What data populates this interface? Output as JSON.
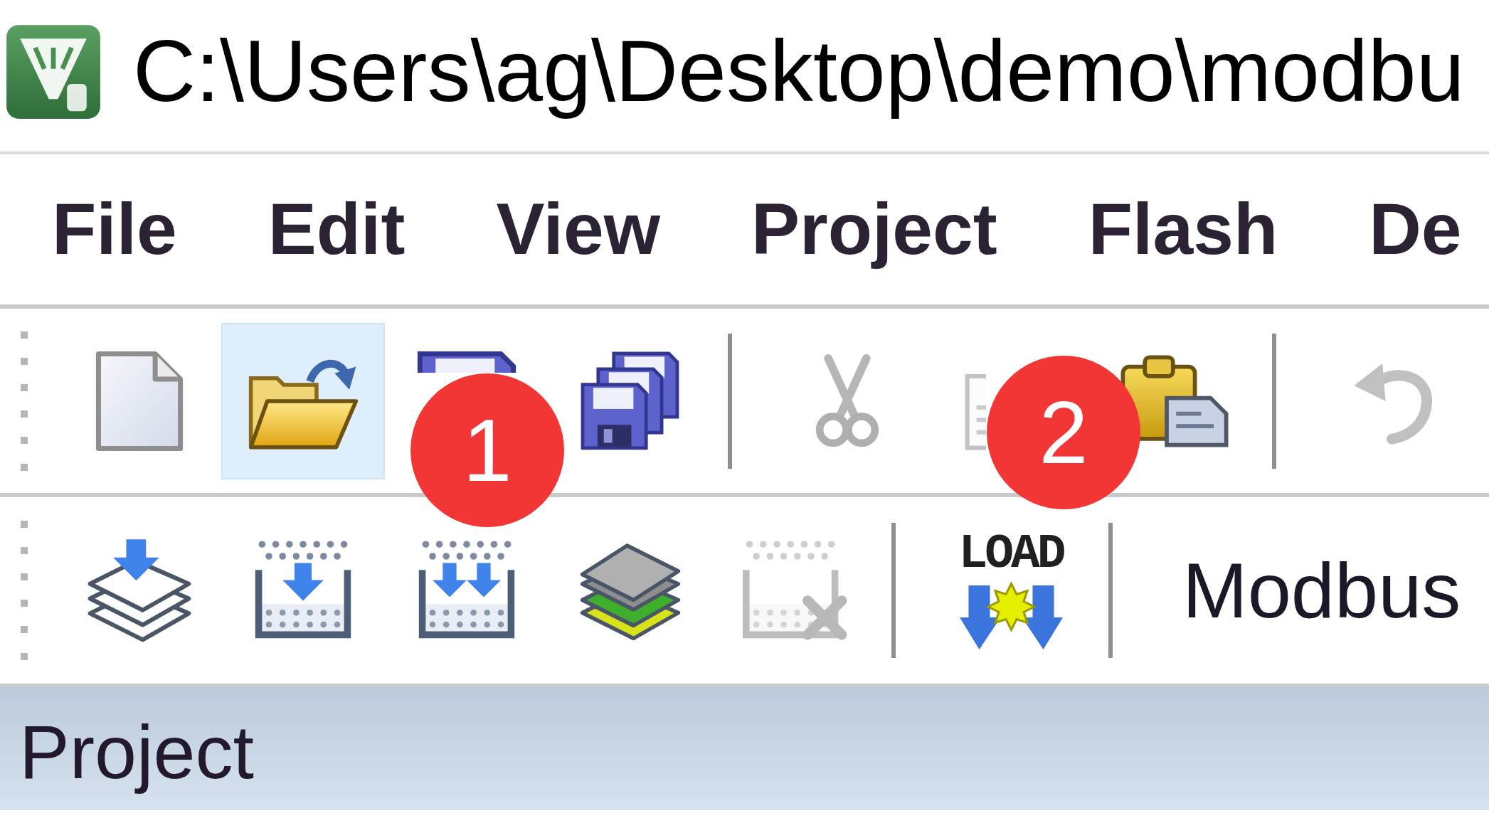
{
  "window": {
    "title": "C:\\Users\\ag\\Desktop\\demo\\modbu"
  },
  "menu_bar": [
    "File",
    "Edit",
    "View",
    "Project",
    "Flash",
    "De"
  ],
  "toolbars": [
    {
      "groups": [
        [
          {
            "disabled": false,
            "hovered": false
          },
          {
            "disabled": false,
            "hovered": true
          },
          {
            "disabled": false,
            "hovered": false
          },
          {
            "disabled": false,
            "hovered": false
          }
        ],
        [
          {
            "disabled": true,
            "hovered": false
          },
          {
            "disabled": true,
            "hovered": false
          },
          {
            "disabled": false,
            "hovered": false
          }
        ],
        [
          {
            "disabled": true,
            "hovered": false
          }
        ]
      ]
    },
    {
      "groups": [
        [
          {
            "disabled": false,
            "hovered": false
          },
          {
            "disabled": false,
            "hovered": false
          },
          {
            "disabled": false,
            "hovered": false
          },
          {
            "disabled": false,
            "hovered": false
          },
          {
            "disabled": true,
            "hovered": false
          }
        ],
        [
          {
            "label": "LOAD",
            "disabled": false,
            "hovered": false
          }
        ]
      ],
      "target": "Modbus"
    }
  ],
  "project_panel": {
    "title": "Project"
  },
  "annotations": [
    "1",
    "2"
  ]
}
